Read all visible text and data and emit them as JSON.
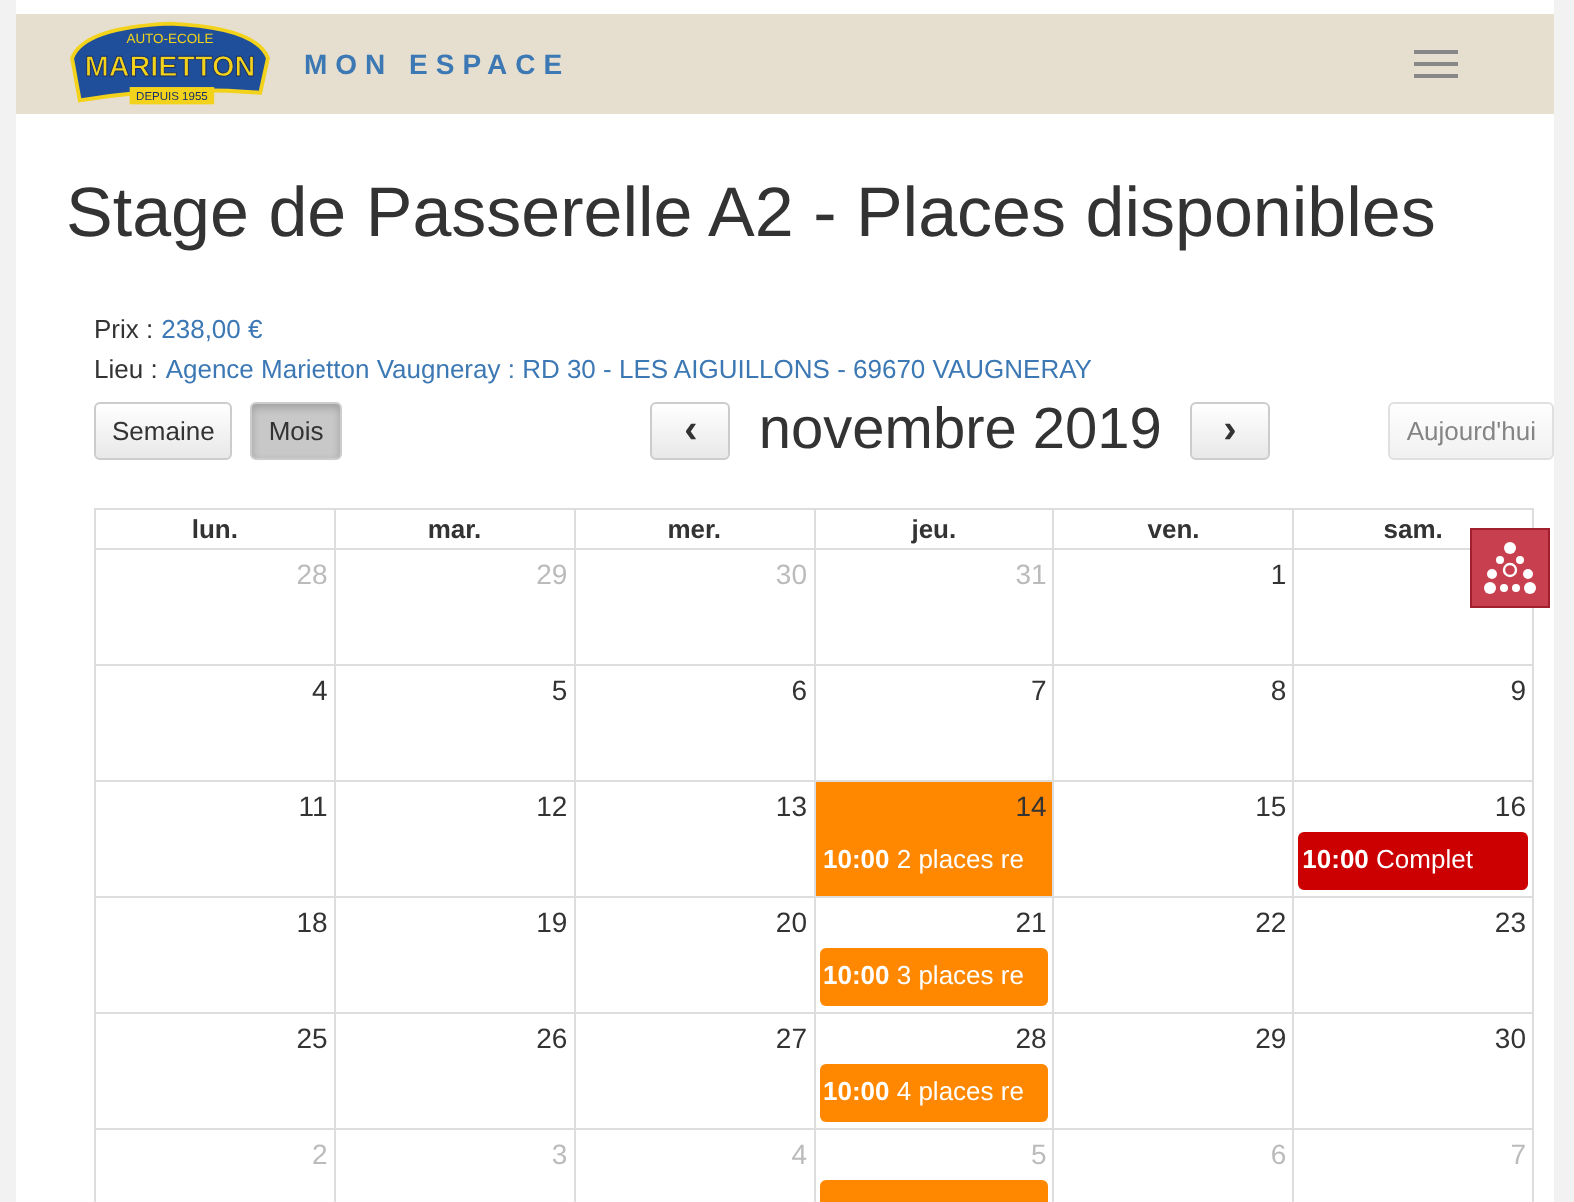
{
  "logo": {
    "top": "AUTO-ECOLE",
    "name": "MARIETTON",
    "since": "DEPUIS 1955"
  },
  "nav": {
    "title": "MON ESPACE"
  },
  "heading": "Stage de Passerelle A2 - Places disponibles",
  "info": [
    {
      "label": "Prix :",
      "value": "238,00 €"
    },
    {
      "label": "Lieu :",
      "value": "Agence Marietton Vaugneray : RD 30 - LES AIGUILLONS - 69670 VAUGNERAY"
    }
  ],
  "views": [
    {
      "label": "Semaine",
      "selected": false
    },
    {
      "label": "Mois",
      "selected": true
    }
  ],
  "prev": "‹",
  "next": "›",
  "month": "novembre 2019",
  "today": {
    "label": "Aujourd'hui",
    "disabled": true
  },
  "weekdays": [
    "lun.",
    "mar.",
    "mer.",
    "jeu.",
    "ven.",
    "sam."
  ],
  "weeks": [
    [
      {
        "day": "28",
        "other": true
      },
      {
        "day": "29",
        "other": true
      },
      {
        "day": "30",
        "other": true
      },
      {
        "day": "31",
        "other": true
      },
      {
        "day": "1",
        "other": false
      }
    ],
    [
      {
        "day": "4",
        "other": false
      },
      {
        "day": "5",
        "other": false
      },
      {
        "day": "6",
        "other": false
      },
      {
        "day": "7",
        "other": false
      },
      {
        "day": "8",
        "other": false
      },
      {
        "day": "9",
        "other": false
      }
    ],
    [
      {
        "day": "11",
        "other": false
      },
      {
        "day": "12",
        "other": false
      },
      {
        "day": "13",
        "other": false
      },
      {
        "day": "14",
        "other": false,
        "highlight": true,
        "event": {
          "time": "10:00",
          "text": "2 places re",
          "color": "#ff8800"
        }
      },
      {
        "day": "15",
        "other": false
      },
      {
        "day": "16",
        "other": false,
        "event": {
          "time": "10:00",
          "text": "Complet",
          "color": "#cc0000"
        }
      }
    ],
    [
      {
        "day": "18",
        "other": false
      },
      {
        "day": "19",
        "other": false
      },
      {
        "day": "20",
        "other": false
      },
      {
        "day": "21",
        "other": false,
        "event": {
          "time": "10:00",
          "text": "3 places re",
          "color": "#ff8800"
        }
      },
      {
        "day": "22",
        "other": false
      },
      {
        "day": "23",
        "other": false
      }
    ],
    [
      {
        "day": "25",
        "other": false
      },
      {
        "day": "26",
        "other": false
      },
      {
        "day": "27",
        "other": false
      },
      {
        "day": "28",
        "other": false,
        "event": {
          "time": "10:00",
          "text": "4 places re",
          "color": "#ff8800"
        }
      },
      {
        "day": "29",
        "other": false
      },
      {
        "day": "30",
        "other": false
      }
    ],
    [
      {
        "day": "2",
        "other": true
      },
      {
        "day": "3",
        "other": true
      },
      {
        "day": "4",
        "other": true
      },
      {
        "day": "5",
        "other": true,
        "event": {
          "color": "#ff8800"
        }
      },
      {
        "day": "6",
        "other": true
      },
      {
        "day": "7",
        "other": true
      }
    ]
  ]
}
